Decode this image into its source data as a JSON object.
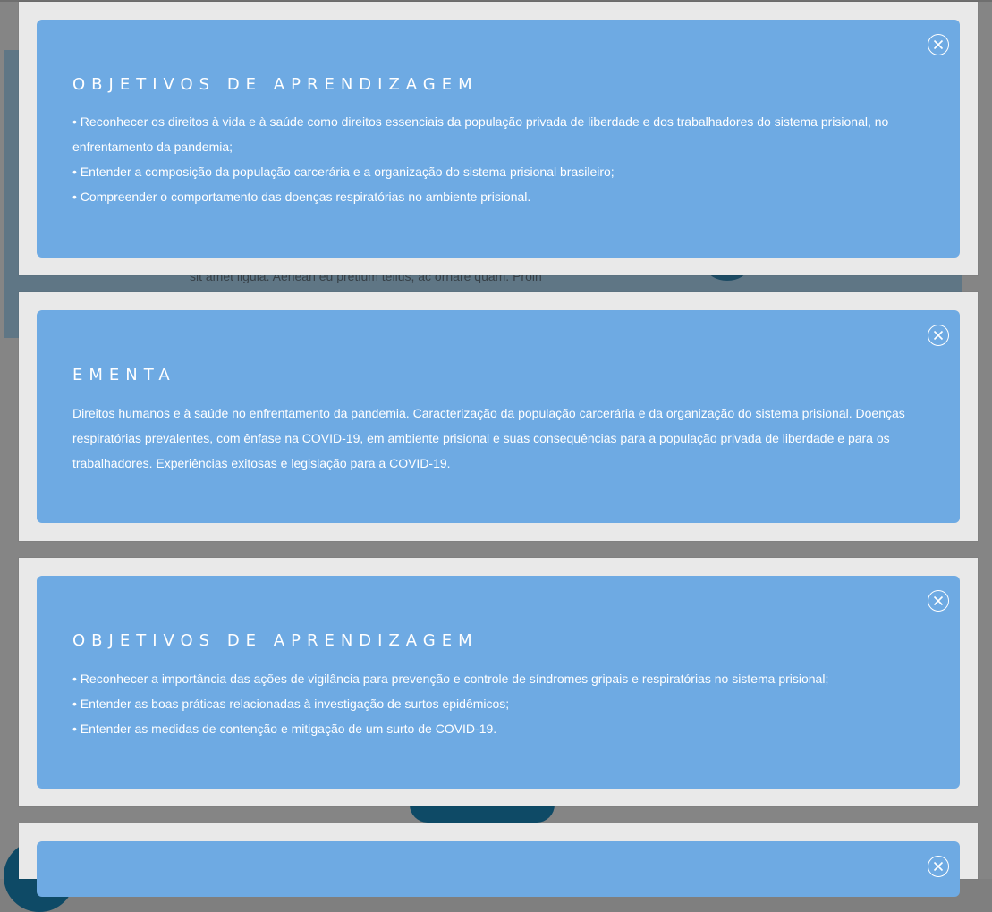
{
  "background_page": {
    "hero_text": "sit amet ligula. Aenean eu pretium tellus, ac ornare quam. Proin"
  },
  "colors": {
    "modal_frame": "#e9e9e9",
    "modal_panel": "#6eaae3",
    "text": "#ffffff"
  },
  "modals": [
    {
      "title": "OBJETIVOS DE APRENDIZAGEM",
      "close_icon": "close-circle-icon",
      "items": [
        "• Reconhecer os direitos à vida e à saúde como direitos essenciais da população privada de liberdade e dos trabalhadores do sistema prisional, no enfrentamento da pandemia;",
        "• Entender a composição da população carcerária e a organização do sistema prisional brasileiro;",
        "• Compreender o comportamento das doenças respiratórias no ambiente prisional."
      ]
    },
    {
      "title": "EMENTA",
      "close_icon": "close-circle-icon",
      "text": "Direitos humanos e à saúde no enfrentamento da pandemia. Caracterização da população carcerária e da organização do sistema prisional. Doenças respiratórias prevalentes, com ênfase na COVID-19, em ambiente prisional e suas consequências para a população privada de liberdade e para os trabalhadores. Experiências exitosas e legislação para a COVID-19."
    },
    {
      "title": "OBJETIVOS DE APRENDIZAGEM",
      "close_icon": "close-circle-icon",
      "items": [
        "• Reconhecer a importância das ações de vigilância para prevenção e controle de síndromes gripais e respiratórias no sistema prisional;",
        "• Entender as boas práticas relacionadas à investigação de surtos epidêmicos;",
        "• Entender as medidas de contenção e mitigação de um surto de COVID-19."
      ]
    },
    {
      "close_icon": "close-circle-icon"
    }
  ]
}
